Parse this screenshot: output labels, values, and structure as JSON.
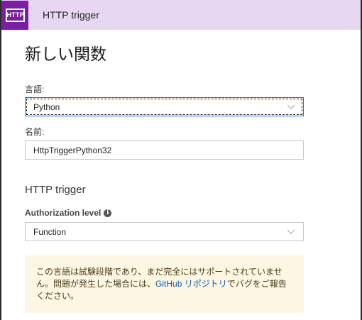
{
  "header": {
    "logo_text": "HTTP",
    "title": "HTTP trigger"
  },
  "page": {
    "title": "新しい関数"
  },
  "language": {
    "label": "言語:",
    "value": "Python"
  },
  "name": {
    "label": "名前:",
    "value": "HttpTriggerPython32"
  },
  "trigger": {
    "title": "HTTP trigger",
    "auth_label": "Authorization level",
    "auth_value": "Function"
  },
  "notice": {
    "text_before": "この言語は試験段階であり、まだ完全にはサポートされていません。問題が発生した場合には、",
    "link": "GitHub リポジトリ",
    "text_after": "でバグをご報告ください。"
  },
  "colors": {
    "header_bg": "#e8d7f3",
    "logo_bg": "#7b1fa2",
    "notice_bg": "#fdf6e3",
    "link": "#0b5ea8",
    "focus_border": "#1e6fd9"
  },
  "icons": {
    "logo": "http-logo-icon",
    "info": "info-icon",
    "chevron": "chevron-down-icon"
  }
}
